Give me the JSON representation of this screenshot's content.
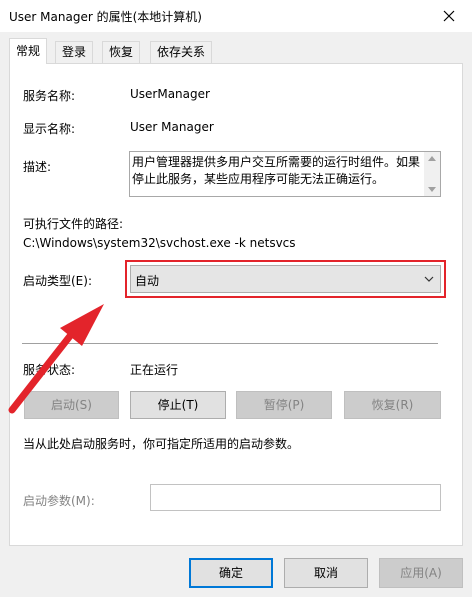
{
  "window": {
    "title": "User Manager 的属性(本地计算机)"
  },
  "tabs": [
    {
      "label": "常规",
      "active": true
    },
    {
      "label": "登录",
      "active": false
    },
    {
      "label": "恢复",
      "active": false
    },
    {
      "label": "依存关系",
      "active": false
    }
  ],
  "general": {
    "service_name_label": "服务名称:",
    "service_name_value": "UserManager",
    "display_name_label": "显示名称:",
    "display_name_value": "User Manager",
    "description_label": "描述:",
    "description_value": "用户管理器提供多用户交互所需要的运行时组件。如果停止此服务，某些应用程序可能无法正确运行。",
    "exe_path_label": "可执行文件的路径:",
    "exe_path_value": "C:\\Windows\\system32\\svchost.exe -k netsvcs",
    "startup_type_label": "启动类型(E):",
    "startup_type_value": "自动",
    "service_status_label": "服务状态:",
    "service_status_value": "正在运行",
    "start_button": "启动(S)",
    "stop_button": "停止(T)",
    "pause_button": "暂停(P)",
    "resume_button": "恢复(R)",
    "hint_text": "当从此处启动服务时，你可指定所适用的启动参数。",
    "start_params_label": "启动参数(M):",
    "start_params_value": ""
  },
  "footer": {
    "ok_button": "确定",
    "cancel_button": "取消",
    "apply_button": "应用(A)"
  },
  "colors": {
    "annotation_red": "#e3242b",
    "primary_border": "#0078d7"
  },
  "icons": {
    "close": "close-icon",
    "dropdown": "chevron-down-icon",
    "annotation": "arrow-annotation"
  }
}
